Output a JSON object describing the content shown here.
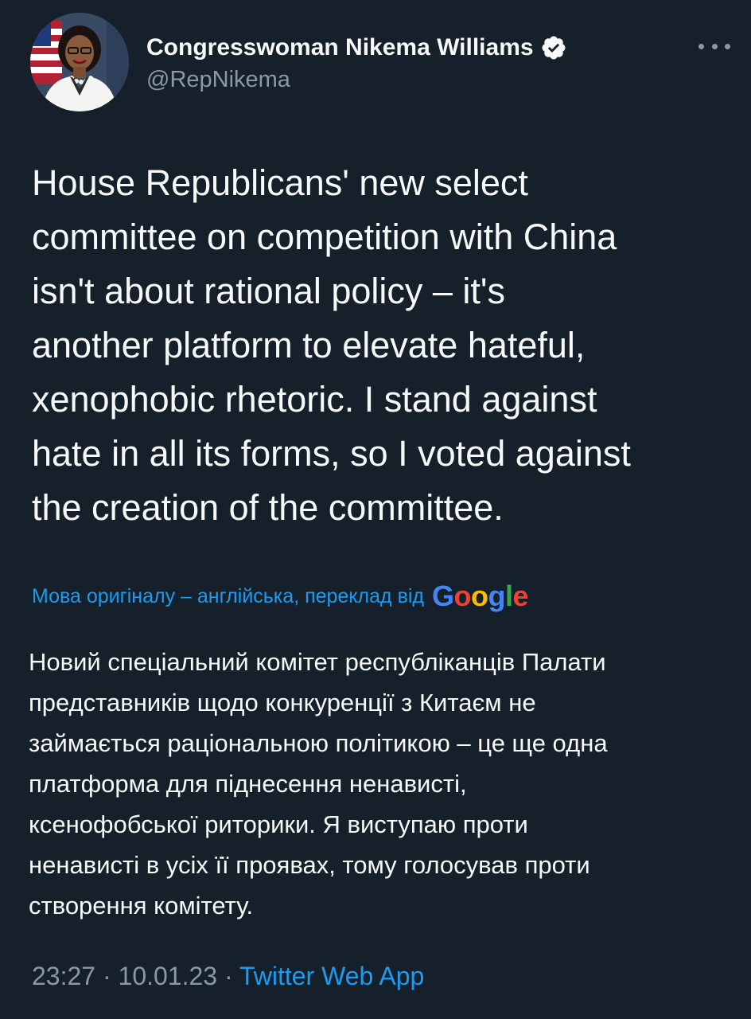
{
  "tweet": {
    "author": {
      "display_name": "Congresswoman Nikema Williams",
      "handle": "@RepNikema",
      "verified": true
    },
    "text_lines": [
      "House Republicans' new select",
      "committee on competition with China",
      "isn't about rational policy – it's",
      "another platform to elevate hateful,",
      "xenophobic rhetoric. I stand against",
      "hate in all its forms, so I voted against",
      "the creation of the committee."
    ],
    "translation": {
      "label": "Мова оригіналу – англійська, переклад від",
      "provider": "Google",
      "text_lines": [
        "Новий спеціальний комітет республіканців Палати",
        "представників щодо конкуренції з Китаєм не",
        "займається раціональною політикою – це ще одна",
        "платформа для піднесення ненависті,",
        "ксенофобської риторики. Я виступаю проти",
        "ненависті в усіх її проявах, тому голосував проти",
        "створення комітету."
      ]
    },
    "time": "23:27",
    "date": "10.01.23",
    "separator": "·",
    "source": "Twitter Web App"
  },
  "icons": {
    "verified": "verified-badge-icon",
    "more": "more-options-icon"
  },
  "colors": {
    "background": "#15202b",
    "text": "#f7f9f9",
    "secondary": "#8b98a5",
    "link": "#1d9bf0",
    "google_blue": "#4285f4",
    "google_red": "#ea4335",
    "google_yellow": "#fbbc05",
    "google_green": "#34a853"
  }
}
